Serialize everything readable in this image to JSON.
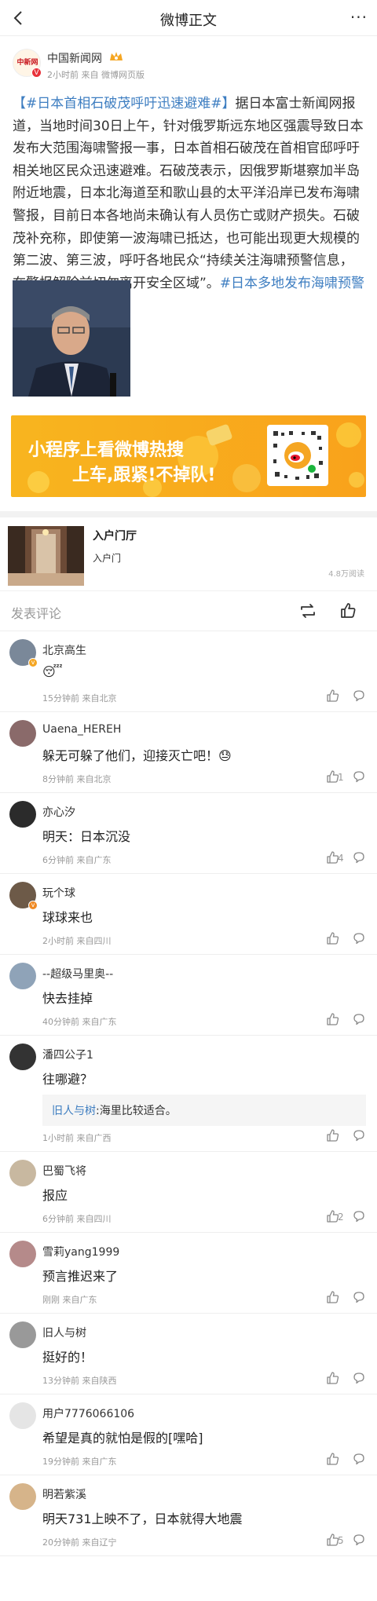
{
  "header": {
    "title": "微博正文",
    "more": "···"
  },
  "post": {
    "author": "中国新闻网",
    "avatar_text": "中新网",
    "meta": "2小时前 来自 微博网页版",
    "tag1": "【#日本首相石破茂呼吁迅速避难#】",
    "body": "据日本富士新闻网报道，当地时间30日上午，针对俄罗斯远东地区强震导致日本发布大范围海啸警报一事，日本首相石破茂在首相官邸呼吁相关地区民众迅速避难。石破茂表示，因俄罗斯堪察加半岛附近地震，日本北海道至和歌山县的太平洋沿岸已发布海啸警报，目前日本各地尚未确认有人员伤亡或财产损失。石破茂补充称，即使第一波海啸已抵达，也可能出现更大规模的第二波、第三波，呼吁各地民众“持续关注海啸预警信息，在警报解除前切勿离开安全区域”。",
    "tag2": "#日本多地发布海啸预警#"
  },
  "banner": {
    "line1": "小程序上看微博热搜",
    "line2": "上车,跟紧!不掉队!"
  },
  "card": {
    "title": "入户门厅",
    "subtitle": "入户门",
    "reads": "4.8万阅读"
  },
  "actions": {
    "comment_placeholder": "发表评论"
  },
  "comments": [
    {
      "name": "北京高生",
      "text": "😴",
      "meta": "15分钟前 来自北京",
      "likes": "",
      "avatar_color": "#7a8899",
      "badge_color": "#f5a623"
    },
    {
      "name": "Uaena_HEREH",
      "text": "躲无可躲了他们，迎接灭亡吧！😓",
      "meta": "8分钟前 来自北京",
      "likes": "1",
      "avatar_color": "#8a6a6a",
      "badge_color": ""
    },
    {
      "name": "亦心汐",
      "text": "明天：日本沉没",
      "meta": "6分钟前 来自广东",
      "likes": "4",
      "avatar_color": "#2b2b2b",
      "badge_color": ""
    },
    {
      "name": "玩个球",
      "text": "球球来也",
      "meta": "2小时前 来自四川",
      "likes": "",
      "avatar_color": "#6d5a48",
      "badge_color": "#f08a24"
    },
    {
      "name": "--超级马里奥--",
      "text": "快去挂掉",
      "meta": "40分钟前 来自广东",
      "likes": "",
      "avatar_color": "#8fa3b8",
      "badge_color": ""
    },
    {
      "name": "潘四公子1",
      "text": "往哪避？",
      "meta": "1小时前 来自广西",
      "likes": "",
      "avatar_color": "#333333",
      "badge_color": "",
      "reply_name": "旧人与树",
      "reply_text": ":海里比较适合。"
    },
    {
      "name": "巴蜀飞将",
      "text": "报应",
      "meta": "6分钟前 来自四川",
      "likes": "2",
      "avatar_color": "#c8b8a0",
      "badge_color": ""
    },
    {
      "name": "雪莉yang1999",
      "text": "预言推迟来了",
      "meta": "刚刚 来自广东",
      "likes": "",
      "avatar_color": "#b58a8a",
      "badge_color": ""
    },
    {
      "name": "旧人与树",
      "text": "挺好的！",
      "meta": "13分钟前 来自陕西",
      "likes": "",
      "avatar_color": "#999999",
      "badge_color": ""
    },
    {
      "name": "用户7776066106",
      "text": "希望是真的就怕是假的[嘿哈]",
      "meta": "19分钟前 来自广东",
      "likes": "",
      "avatar_color": "#e5e5e5",
      "badge_color": ""
    },
    {
      "name": "明若紫溪",
      "text": "明天731上映不了，日本就得大地震",
      "meta": "20分钟前 来自辽宁",
      "likes": "5",
      "avatar_color": "#d6b48a",
      "badge_color": ""
    }
  ]
}
